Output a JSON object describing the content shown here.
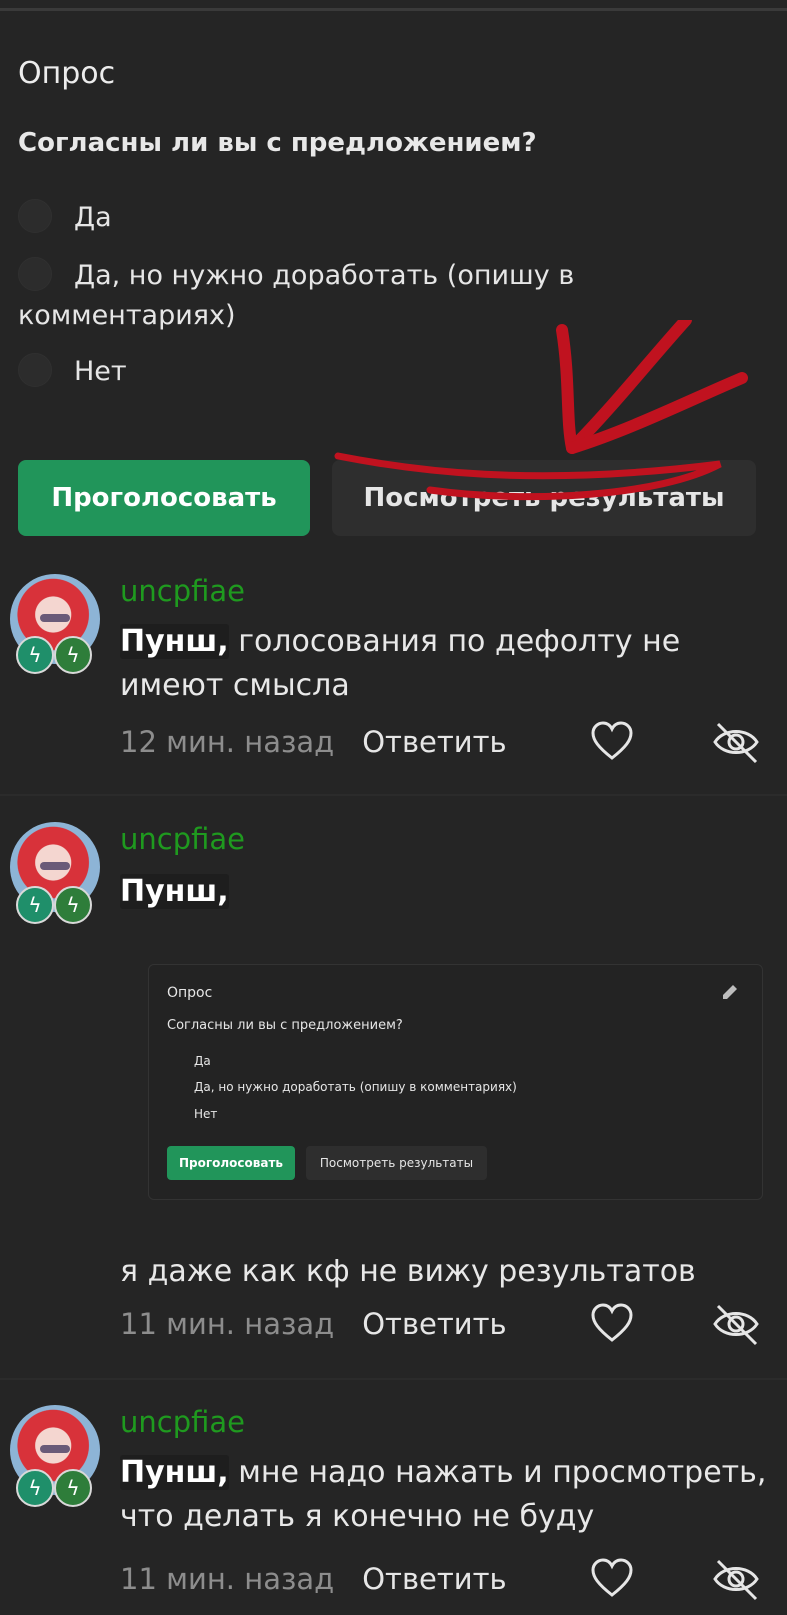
{
  "poll": {
    "title": "Опрос",
    "question": "Согласны ли вы с предложением?",
    "options": [
      "Да",
      "Да, но нужно доработать (опишу в комментариях)",
      "Нет"
    ],
    "vote_label": "Проголосовать",
    "results_label": "Посмотреть результаты"
  },
  "colors": {
    "accent_green": "#21955a",
    "username_green": "#1f9a1f",
    "annotation_red": "#c0121f",
    "background": "#252525"
  },
  "comments": [
    {
      "username": "uncpfiae",
      "mention": "Пунш,",
      "text": " голосования по дефолту не имеют смысла",
      "time": "12 мин. назад",
      "reply_label": "Ответить",
      "badges": [
        "lightning-badge",
        "lightning-badge"
      ]
    },
    {
      "username": "uncpfiae",
      "mention": "Пунш,",
      "text": "я даже как кф не вижу результатов",
      "time": "11 мин. назад",
      "reply_label": "Ответить",
      "embedded_poll": {
        "title": "Опрос",
        "question": "Согласны ли вы с предложением?",
        "options": [
          "Да",
          "Да, но нужно доработать (опишу в комментариях)",
          "Нет"
        ],
        "vote_label": "Проголосовать",
        "results_label": "Посмотреть результаты"
      }
    },
    {
      "username": "uncpfiae",
      "mention": "Пунш,",
      "text": " мне надо нажать и просмотреть, что делать я конечно не буду",
      "time": "11 мин. назад",
      "reply_label": "Ответить"
    }
  ],
  "icons": {
    "like": "heart-icon",
    "hide": "eye-slash-icon",
    "badge": "lightning-icon",
    "edit": "pencil-icon"
  }
}
